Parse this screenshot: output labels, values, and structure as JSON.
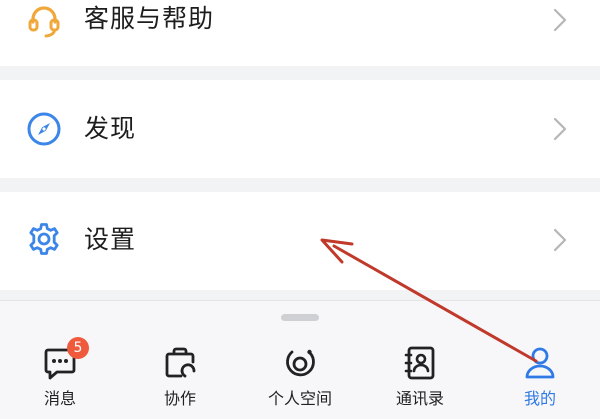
{
  "menu": {
    "support": {
      "label": "客服与帮助",
      "icon": "headset-icon",
      "icon_color": "#f0a83a"
    },
    "discover": {
      "label": "发现",
      "icon": "compass-icon",
      "icon_color": "#3b86e8"
    },
    "settings": {
      "label": "设置",
      "icon": "gear-icon",
      "icon_color": "#3b86e8"
    }
  },
  "tabbar": {
    "tabs": [
      {
        "label": "消息",
        "icon": "message-icon",
        "badge": "5"
      },
      {
        "label": "协作",
        "icon": "collaborate-icon"
      },
      {
        "label": "个人空间",
        "icon": "personal-space-icon"
      },
      {
        "label": "通讯录",
        "icon": "contacts-icon"
      },
      {
        "label": "我的",
        "icon": "profile-icon",
        "active": true
      }
    ]
  },
  "colors": {
    "accent": "#2f7ae5",
    "badge": "#f05a3c",
    "annotation_arrow": "#c0392b",
    "background": "#f2f3f5"
  }
}
